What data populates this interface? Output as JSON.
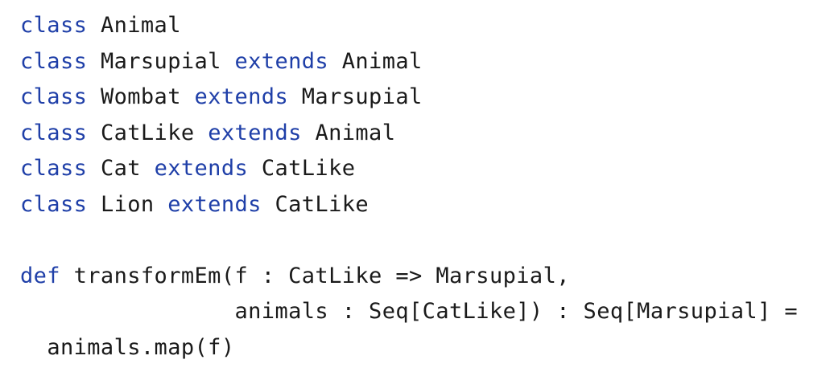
{
  "code": {
    "lines": [
      {
        "kw1": "class",
        "name": "Animal",
        "kw2": "",
        "parent": ""
      },
      {
        "kw1": "class",
        "name": "Marsupial",
        "kw2": "extends",
        "parent": "Animal"
      },
      {
        "kw1": "class",
        "name": "Wombat",
        "kw2": "extends",
        "parent": "Marsupial"
      },
      {
        "kw1": "class",
        "name": "CatLike",
        "kw2": "extends",
        "parent": "Animal"
      },
      {
        "kw1": "class",
        "name": "Cat",
        "kw2": "extends",
        "parent": "CatLike"
      },
      {
        "kw1": "class",
        "name": "Lion",
        "kw2": "extends",
        "parent": "CatLike"
      }
    ],
    "def_keyword": "def",
    "def_signature": "transformEm(f : CatLike => Marsupial,",
    "def_continuation": "animals : Seq[CatLike]) : Seq[Marsupial] =",
    "def_body": "animals.map(f)"
  },
  "colors": {
    "keyword": "#1f3fa8",
    "text": "#1a1a1a",
    "background": "#ffffff"
  }
}
